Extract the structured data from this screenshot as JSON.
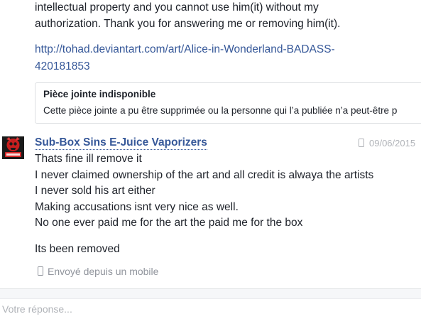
{
  "previous_message": {
    "line1": "intellectual property and you cannot use him(it) without my",
    "line2": "authorization. Thank you for answering me or removing him(it).",
    "link_line1": "http://tohad.deviantart.com/art/Alice-in-Wonderland-BADASS-",
    "link_line2": "420181853",
    "attachment": {
      "title": "Pièce jointe indisponible",
      "description": "Cette pièce jointe a pu être supprimée ou la personne qui l’a publiée n’a peut-être p"
    }
  },
  "message": {
    "sender": "Sub-Box Sins E-Juice Vaporizers",
    "date": "09/06/2015",
    "lines": [
      "Thats fine ill remove it",
      "I never claimed ownership of the art and all credit is alwaya the artists",
      "I never sold his art either",
      "Making accusations isnt very nice as well.",
      "No one ever paid me for the art the paid me for the box"
    ],
    "followup": "Its been removed",
    "sent_from": "Envoyé depuis un mobile"
  },
  "reply": {
    "placeholder": "Votre réponse..."
  },
  "colors": {
    "link": "#365899",
    "text": "#1d2129",
    "muted": "#90949c",
    "border": "#dddfe2"
  },
  "icons": {
    "date_icon": "mobile-phone-icon",
    "sent_icon": "mobile-phone-icon"
  }
}
